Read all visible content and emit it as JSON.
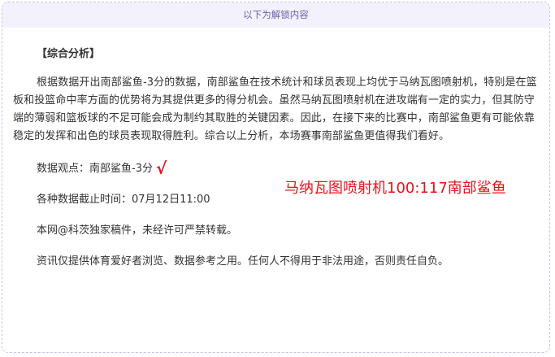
{
  "banner": {
    "text": "以下为解锁内容"
  },
  "article": {
    "heading": "【综合分析】",
    "analysis": "根据数据开出南部鲨鱼-3分的数据，南部鲨鱼在技术统计和球员表现上均优于马纳瓦图喷射机，特别是在篮板和投篮命中率方面的优势将为其提供更多的得分机会。虽然马纳瓦图喷射机在进攻端有一定的实力，但其防守端的薄弱和篮板球的不足可能会成为制约其取胜的关键因素。因此，在接下来的比赛中，南部鲨鱼更有可能依靠稳定的发挥和出色的球员表现取得胜利。综合以上分析，本场赛事南部鲨鱼更值得我们看好。",
    "viewpoint": "数据观点：南部鲨鱼-3分",
    "check_mark": "√",
    "score_result": "马纳瓦图喷射机100:117南部鲨鱼",
    "deadline": "各种数据截止时间：07月12日11:00",
    "copyright": "本网@科茨独家稿件，未经许可严禁转载。",
    "disclaimer": "资讯仅提供体育爱好者浏览、数据参考之用。任何人不得用于非法用途，否则责任自负。"
  },
  "colors": {
    "border": "#c9c1ea",
    "banner_bg": "#f3f1fb",
    "banner_text": "#6c64a8",
    "accent_red": "#e8121c",
    "body_text": "#333333"
  }
}
